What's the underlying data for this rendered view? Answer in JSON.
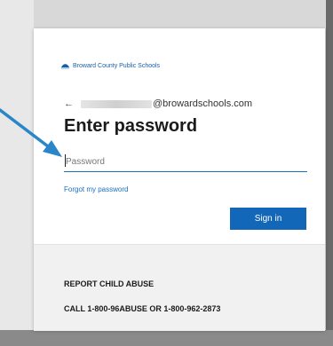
{
  "logo": {
    "text": "Broward County Public Schools",
    "color": "#1b5ea8"
  },
  "identity": {
    "back_icon": "arrow-left-icon",
    "email_suffix": "@browardschools.com"
  },
  "title": "Enter password",
  "password_field": {
    "value": "",
    "placeholder": "Password"
  },
  "forgot_link": "Forgot my password",
  "signin_button": "Sign in",
  "footer": {
    "line1": "REPORT CHILD ABUSE",
    "line2": "CALL 1-800-96ABUSE OR 1-800-962-2873"
  },
  "annotation": {
    "icon": "pointer-arrow-icon",
    "color": "#2a86c9"
  },
  "colors": {
    "accent": "#1367b8",
    "link": "#1b6fbf",
    "background": "#d8d8d8"
  }
}
